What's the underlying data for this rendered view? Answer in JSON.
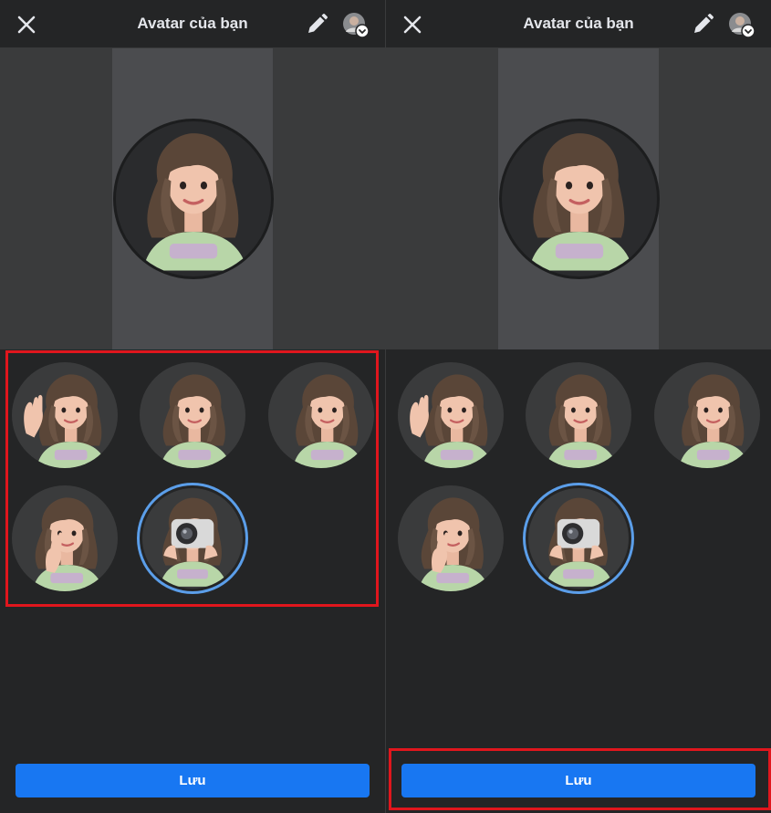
{
  "screens": [
    {
      "header": {
        "title": "Avatar của bạn"
      },
      "save_label": "Lưu",
      "highlight": "poses-grid"
    },
    {
      "header": {
        "title": "Avatar của bạn"
      },
      "save_label": "Lưu",
      "highlight": "save-button"
    }
  ],
  "icons": {
    "close": "close-icon",
    "edit": "pencil-icon",
    "profile": "profile-picture-icon",
    "badge": "chevron-down-icon"
  },
  "poses": [
    "wave",
    "smile",
    "side-smile",
    "peace-sign",
    "camera"
  ],
  "selected_pose": "camera",
  "colors": {
    "background": "#242526",
    "accent": "#1877f2",
    "selection_ring": "#5b9ee9",
    "highlight": "#e0161d"
  }
}
